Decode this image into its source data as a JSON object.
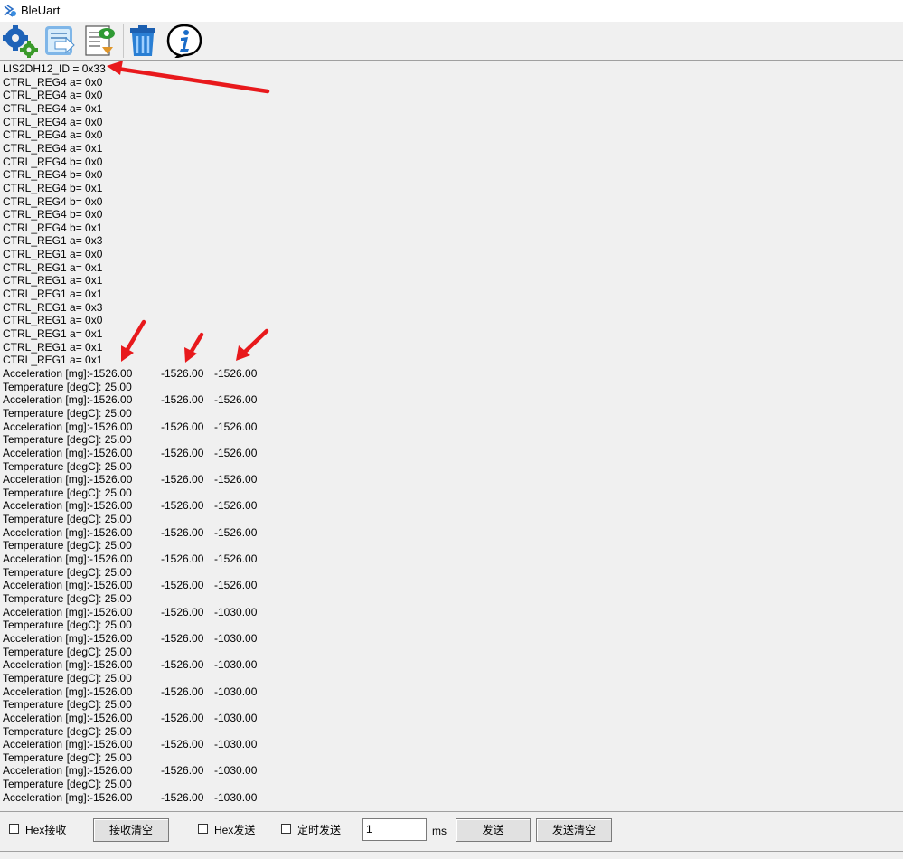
{
  "window": {
    "title": "BleUart"
  },
  "toolbar": {
    "buttons": [
      {
        "icon": "settings-gears-icon"
      },
      {
        "icon": "export-document-icon"
      },
      {
        "icon": "view-log-icon"
      },
      {
        "icon": "trash-icon"
      },
      {
        "icon": "info-icon"
      }
    ]
  },
  "log": {
    "id_line": "LIS2DH12_ID = 0x33",
    "reg_lines": [
      "CTRL_REG4 a= 0x0",
      "CTRL_REG4 a= 0x0",
      "CTRL_REG4 a= 0x1",
      "CTRL_REG4 a= 0x0",
      "CTRL_REG4 a= 0x0",
      "CTRL_REG4 a= 0x1",
      "CTRL_REG4 b= 0x0",
      "CTRL_REG4 b= 0x0",
      "CTRL_REG4 b= 0x1",
      "CTRL_REG4 b= 0x0",
      "CTRL_REG4 b= 0x0",
      "CTRL_REG4 b= 0x1",
      "CTRL_REG1 a= 0x3",
      "CTRL_REG1 a= 0x0",
      "CTRL_REG1 a= 0x1",
      "CTRL_REG1 a= 0x1",
      "CTRL_REG1 a= 0x1",
      "CTRL_REG1 a= 0x3",
      "CTRL_REG1 a= 0x0",
      "CTRL_REG1 a= 0x1",
      "CTRL_REG1 a= 0x1",
      "CTRL_REG1 a= 0x1"
    ],
    "accel_label": "Acceleration [mg]:",
    "temp_line": "Temperature [degC]: 25.00",
    "samples": [
      {
        "x": "-1526.00",
        "y": "-1526.00",
        "z": "-1526.00"
      },
      {
        "x": "-1526.00",
        "y": "-1526.00",
        "z": "-1526.00"
      },
      {
        "x": "-1526.00",
        "y": "-1526.00",
        "z": "-1526.00"
      },
      {
        "x": "-1526.00",
        "y": "-1526.00",
        "z": "-1526.00"
      },
      {
        "x": "-1526.00",
        "y": "-1526.00",
        "z": "-1526.00"
      },
      {
        "x": "-1526.00",
        "y": "-1526.00",
        "z": "-1526.00"
      },
      {
        "x": "-1526.00",
        "y": "-1526.00",
        "z": "-1526.00"
      },
      {
        "x": "-1526.00",
        "y": "-1526.00",
        "z": "-1526.00"
      },
      {
        "x": "-1526.00",
        "y": "-1526.00",
        "z": "-1526.00"
      },
      {
        "x": "-1526.00",
        "y": "-1526.00",
        "z": "-1030.00"
      },
      {
        "x": "-1526.00",
        "y": "-1526.00",
        "z": "-1030.00"
      },
      {
        "x": "-1526.00",
        "y": "-1526.00",
        "z": "-1030.00"
      },
      {
        "x": "-1526.00",
        "y": "-1526.00",
        "z": "-1030.00"
      },
      {
        "x": "-1526.00",
        "y": "-1526.00",
        "z": "-1030.00"
      },
      {
        "x": "-1526.00",
        "y": "-1526.00",
        "z": "-1030.00"
      },
      {
        "x": "-1526.00",
        "y": "-1526.00",
        "z": "-1030.00"
      },
      {
        "x": "-1526.00",
        "y": "-1526.00",
        "z": "-1030.00"
      }
    ]
  },
  "controls": {
    "hex_receive_label": "Hex接收",
    "clear_receive_label": "接收清空",
    "hex_send_label": "Hex发送",
    "timed_send_label": "定时发送",
    "interval_value": "1",
    "ms_label": "ms",
    "send_label": "发送",
    "clear_send_label": "发送清空"
  },
  "colors": {
    "annotation_arrow": "#e8191c"
  }
}
